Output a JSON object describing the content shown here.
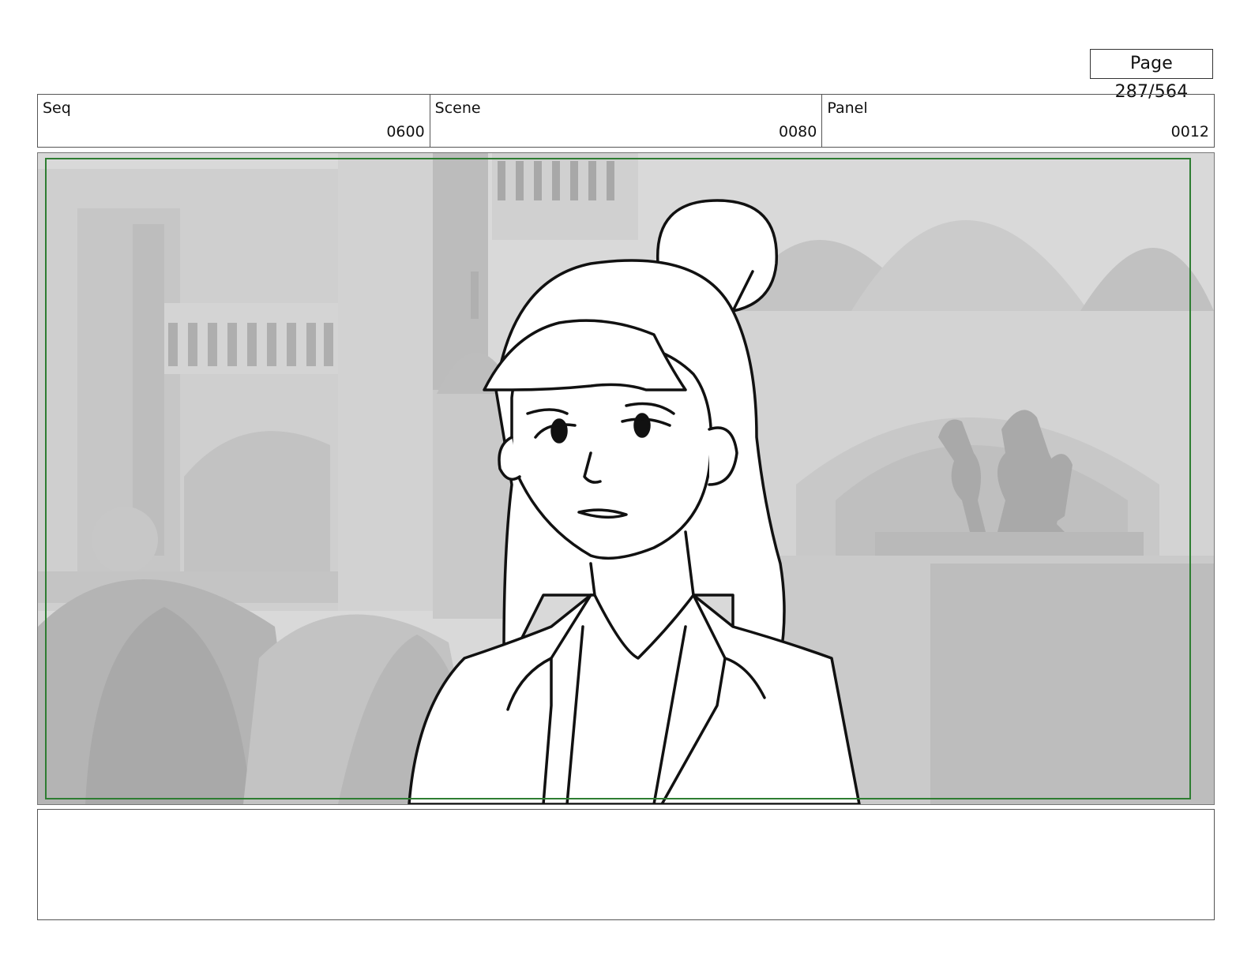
{
  "page": {
    "label": "Page 287/564"
  },
  "info": {
    "seq": {
      "label": "Seq",
      "value": "0600"
    },
    "scene": {
      "label": "Scene",
      "value": "0080"
    },
    "panel": {
      "label": "Panel",
      "value": "0012"
    }
  },
  "frame": {
    "safe_area_color": "#2e7d32",
    "background_tone": "#d6d6d6",
    "line_color": "#111111"
  },
  "notes": {
    "text": ""
  }
}
